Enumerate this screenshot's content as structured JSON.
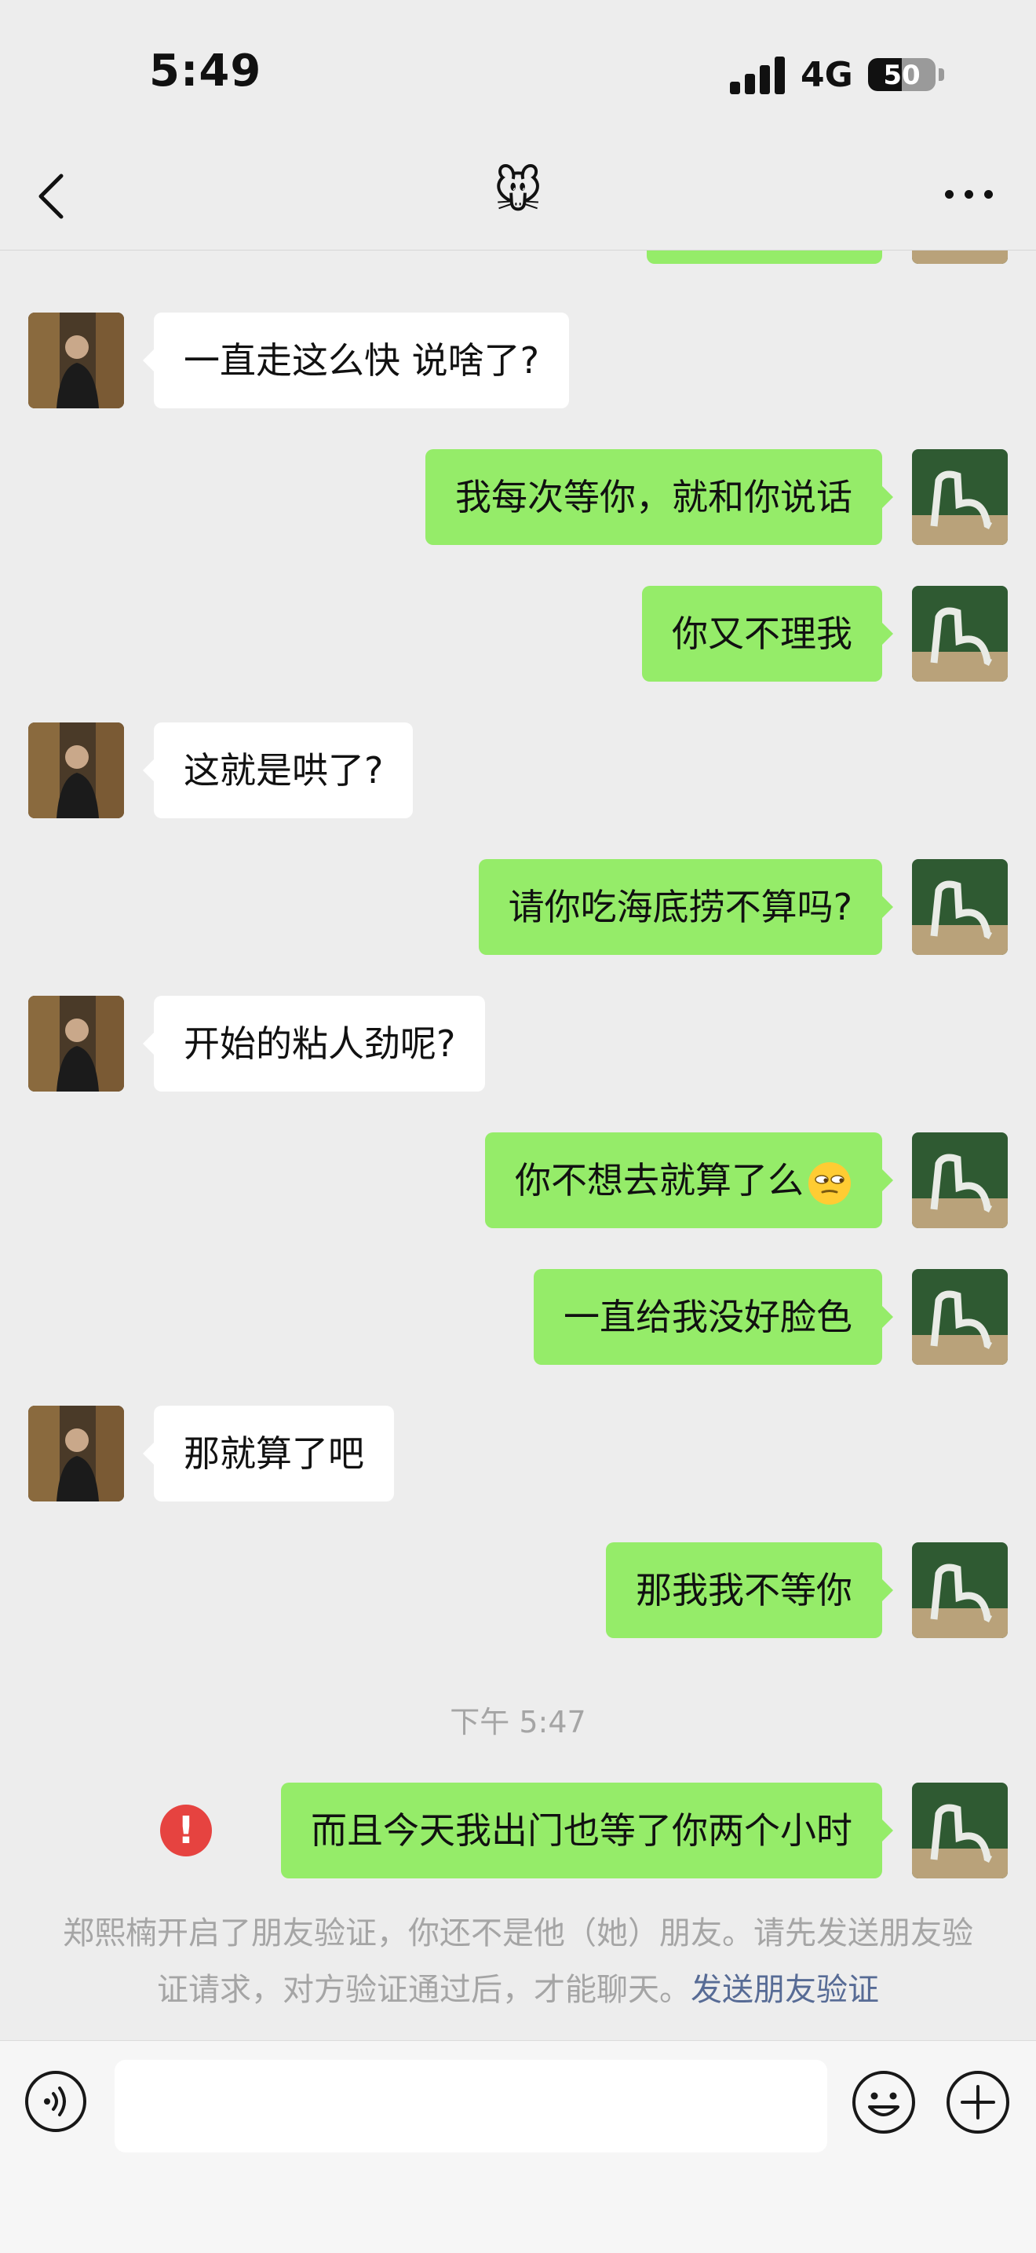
{
  "status_bar": {
    "time": "5:49",
    "network": "4G",
    "battery": "50",
    "battery_level": 0.5
  },
  "nav": {
    "title_icon": "mouse-face-emoji",
    "title": "🐭"
  },
  "messages": [
    {
      "from": "them",
      "text": "一直走这么快 说啥了?"
    },
    {
      "from": "me",
      "text": "我每次等你，就和你说话"
    },
    {
      "from": "me",
      "text": "你又不理我"
    },
    {
      "from": "them",
      "text": "这就是哄了?"
    },
    {
      "from": "me",
      "text": "请你吃海底捞不算吗?"
    },
    {
      "from": "them",
      "text": "开始的粘人劲呢?"
    },
    {
      "from": "me",
      "text": "你不想去就算了么",
      "emoji": "unamused-face-emoji"
    },
    {
      "from": "me",
      "text": "一直给我没好脸色"
    },
    {
      "from": "them",
      "text": "那就算了吧"
    },
    {
      "from": "me",
      "text": "那我我不等你"
    }
  ],
  "timestamp": "下午 5:47",
  "failed_message": {
    "text": "而且今天我出门也等了你两个小时",
    "error_icon": "!"
  },
  "system_notice": {
    "text": "郑熙楠开启了朋友验证，你还不是他（她）朋友。请先发送朋友验证请求，对方验证通过后，才能聊天。",
    "link": "发送朋友验证"
  },
  "input": {
    "value": ""
  },
  "colors": {
    "background": "#ededed",
    "out_bubble": "#95ec69",
    "in_bubble": "#ffffff",
    "link": "#576b95",
    "error": "#e64340"
  }
}
